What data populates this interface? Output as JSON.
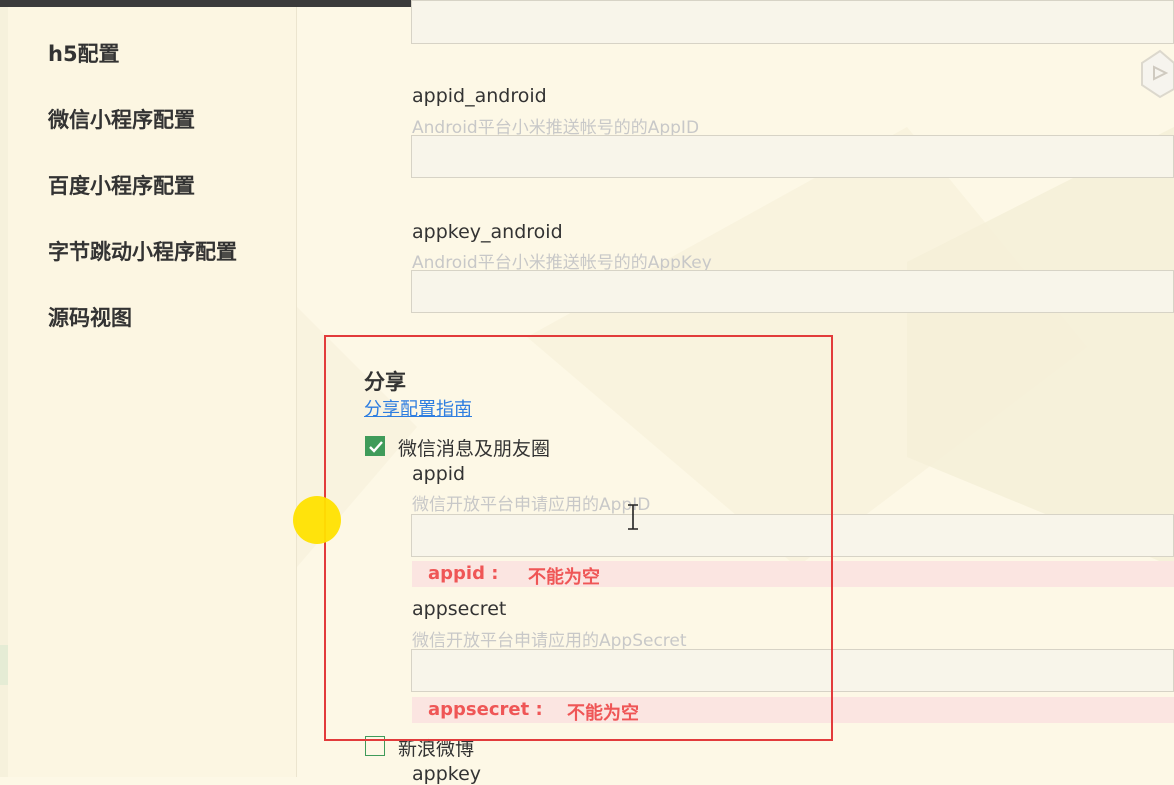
{
  "sidebar": {
    "items": [
      {
        "label": "h5配置"
      },
      {
        "label": "微信小程序配置"
      },
      {
        "label": "百度小程序配置"
      },
      {
        "label": "字节跳动小程序配置"
      },
      {
        "label": "源码视图"
      }
    ]
  },
  "push": {
    "appid_android": {
      "label": "appid_android",
      "hint": "Android平台小米推送帐号的的AppID",
      "value": ""
    },
    "appkey_android": {
      "label": "appkey_android",
      "hint": "Android平台小米推送帐号的的AppKey",
      "value": ""
    }
  },
  "share": {
    "title": "分享",
    "guide_link": "分享配置指南",
    "wechat": {
      "checkbox_label": "微信消息及朋友圈",
      "checked": true,
      "appid": {
        "label": "appid",
        "hint": "微信开放平台申请应用的AppID",
        "value": "",
        "error_key": "appid :",
        "error_msg": "不能为空"
      },
      "appsecret": {
        "label": "appsecret",
        "hint": "微信开放平台申请应用的AppSecret",
        "value": "",
        "error_key": "appsecret :",
        "error_msg": "不能为空"
      }
    },
    "weibo": {
      "checkbox_label": "新浪微博",
      "checked": false,
      "appkey": {
        "label": "appkey"
      }
    }
  },
  "colors": {
    "background": "#fdf8e6",
    "accent_green": "#3f9b5a",
    "error_red": "#ef5656",
    "link_blue": "#2d7de0",
    "highlight_red": "#e23b3b"
  }
}
